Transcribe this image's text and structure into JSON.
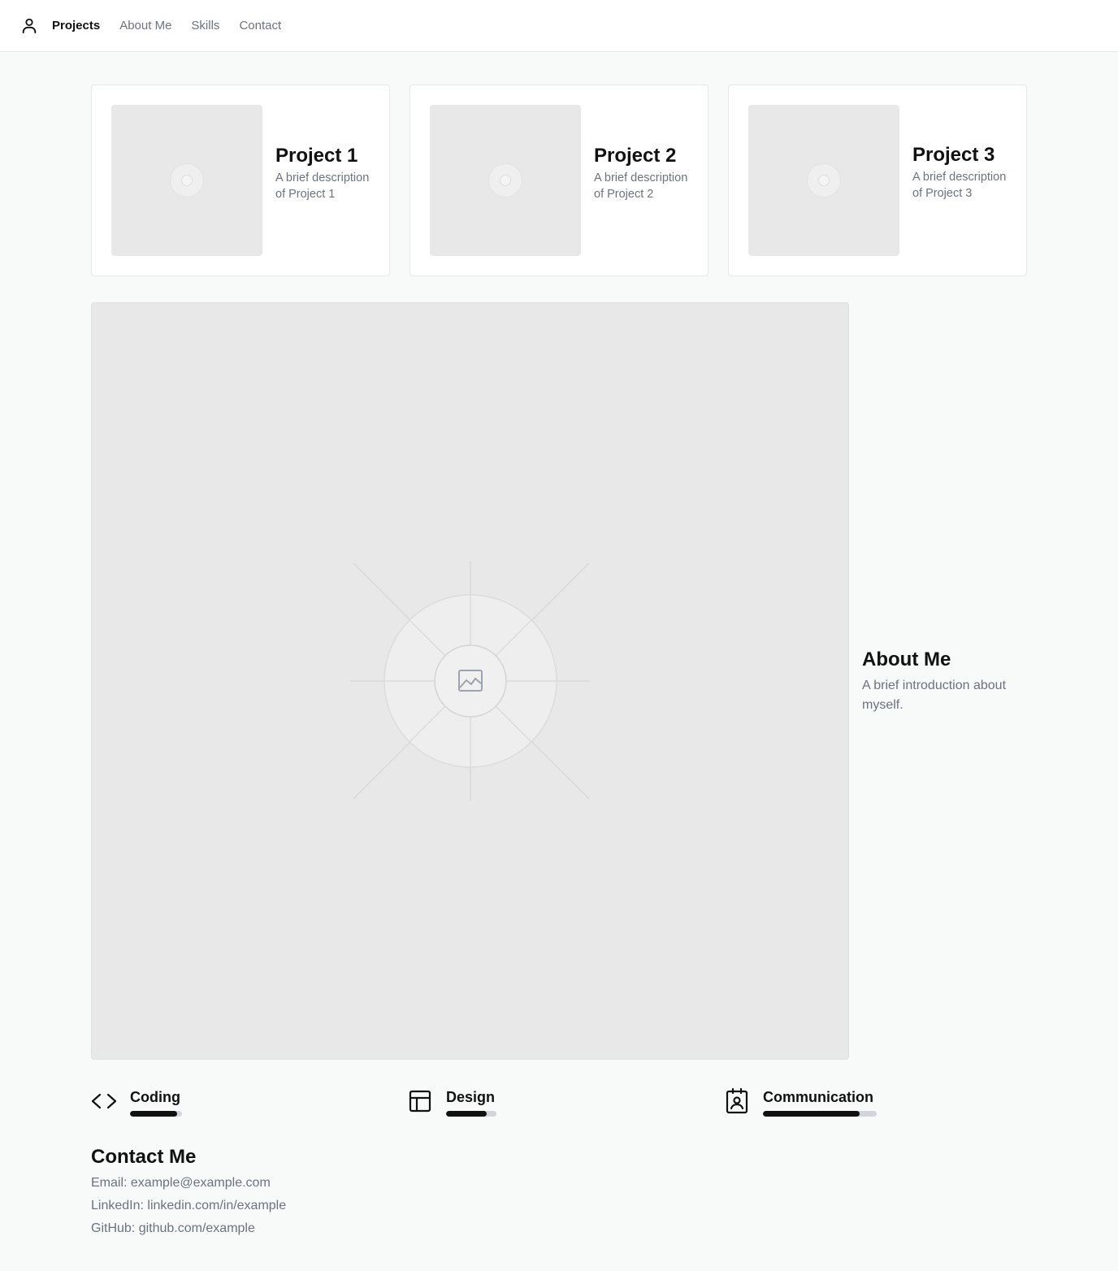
{
  "nav": {
    "logo_icon": "user-icon",
    "links": [
      {
        "label": "Projects",
        "active": true
      },
      {
        "label": "About Me",
        "active": false
      },
      {
        "label": "Skills",
        "active": false
      },
      {
        "label": "Contact",
        "active": false
      }
    ]
  },
  "projects": [
    {
      "title": "Project 1",
      "description": "A brief description of Project 1",
      "image_icon": "image-placeholder-icon"
    },
    {
      "title": "Project 2",
      "description": "A brief description of Project 2",
      "image_icon": "image-placeholder-icon"
    },
    {
      "title": "Project 3",
      "description": "A brief description of Project 3",
      "image_icon": "image-placeholder-icon"
    }
  ],
  "hero": {
    "image_icon": "image-placeholder-icon"
  },
  "about": {
    "title": "About Me",
    "text": "A brief introduction about myself."
  },
  "skills": [
    {
      "name": "Coding",
      "icon": "code-icon",
      "level": 0.9
    },
    {
      "name": "Design",
      "icon": "layout-icon",
      "level": 0.8
    },
    {
      "name": "Communication",
      "icon": "contact-card-icon",
      "level": 0.85
    }
  ],
  "contact": {
    "title": "Contact Me",
    "lines": [
      "Email: example@example.com",
      "LinkedIn: linkedin.com/in/example",
      "GitHub: github.com/example"
    ]
  },
  "colors": {
    "accent": "#111111",
    "muted_text": "#6b7280",
    "page_bg": "#f8f9f9",
    "placeholder_bg": "#e8e8e8",
    "bar_track": "#d1d5db"
  }
}
